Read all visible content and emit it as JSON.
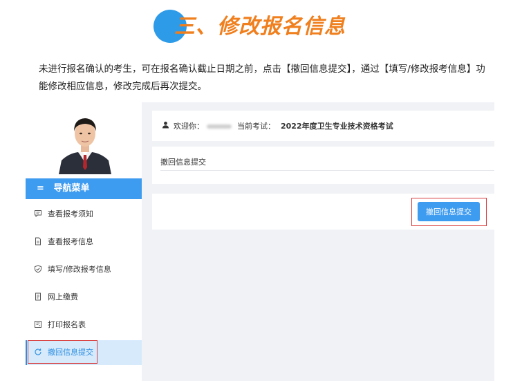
{
  "hero": {
    "title": "三、修改报名信息"
  },
  "intro": {
    "text": "未进行报名确认的考生，可在报名确认截止日期之前，点击【撤回信息提交】，通过【填写/修改报考信息】功能修改相应信息，修改完成后再次提交。"
  },
  "sidebar": {
    "nav_title": "导航菜单",
    "items": [
      {
        "label": "查看报考须知",
        "icon": "chat-icon"
      },
      {
        "label": "查看报考信息",
        "icon": "document-icon"
      },
      {
        "label": "填写/修改报考信息",
        "icon": "shield-check-icon"
      },
      {
        "label": "网上缴费",
        "icon": "receipt-icon"
      },
      {
        "label": "打印报名表",
        "icon": "print-form-icon"
      },
      {
        "label": "撤回信息提交",
        "icon": "refresh-icon",
        "active": true
      }
    ]
  },
  "header": {
    "welcome_label": "欢迎你：",
    "exam_label": "当前考试：",
    "exam_name": "2022年度卫生专业技术资格考试"
  },
  "section": {
    "title": "撤回信息提交"
  },
  "action": {
    "button_label": "撤回信息提交"
  },
  "colors": {
    "accent": "#3d9bf0",
    "title_orange": "#f07f1e",
    "highlight_red": "#d83a3a"
  }
}
